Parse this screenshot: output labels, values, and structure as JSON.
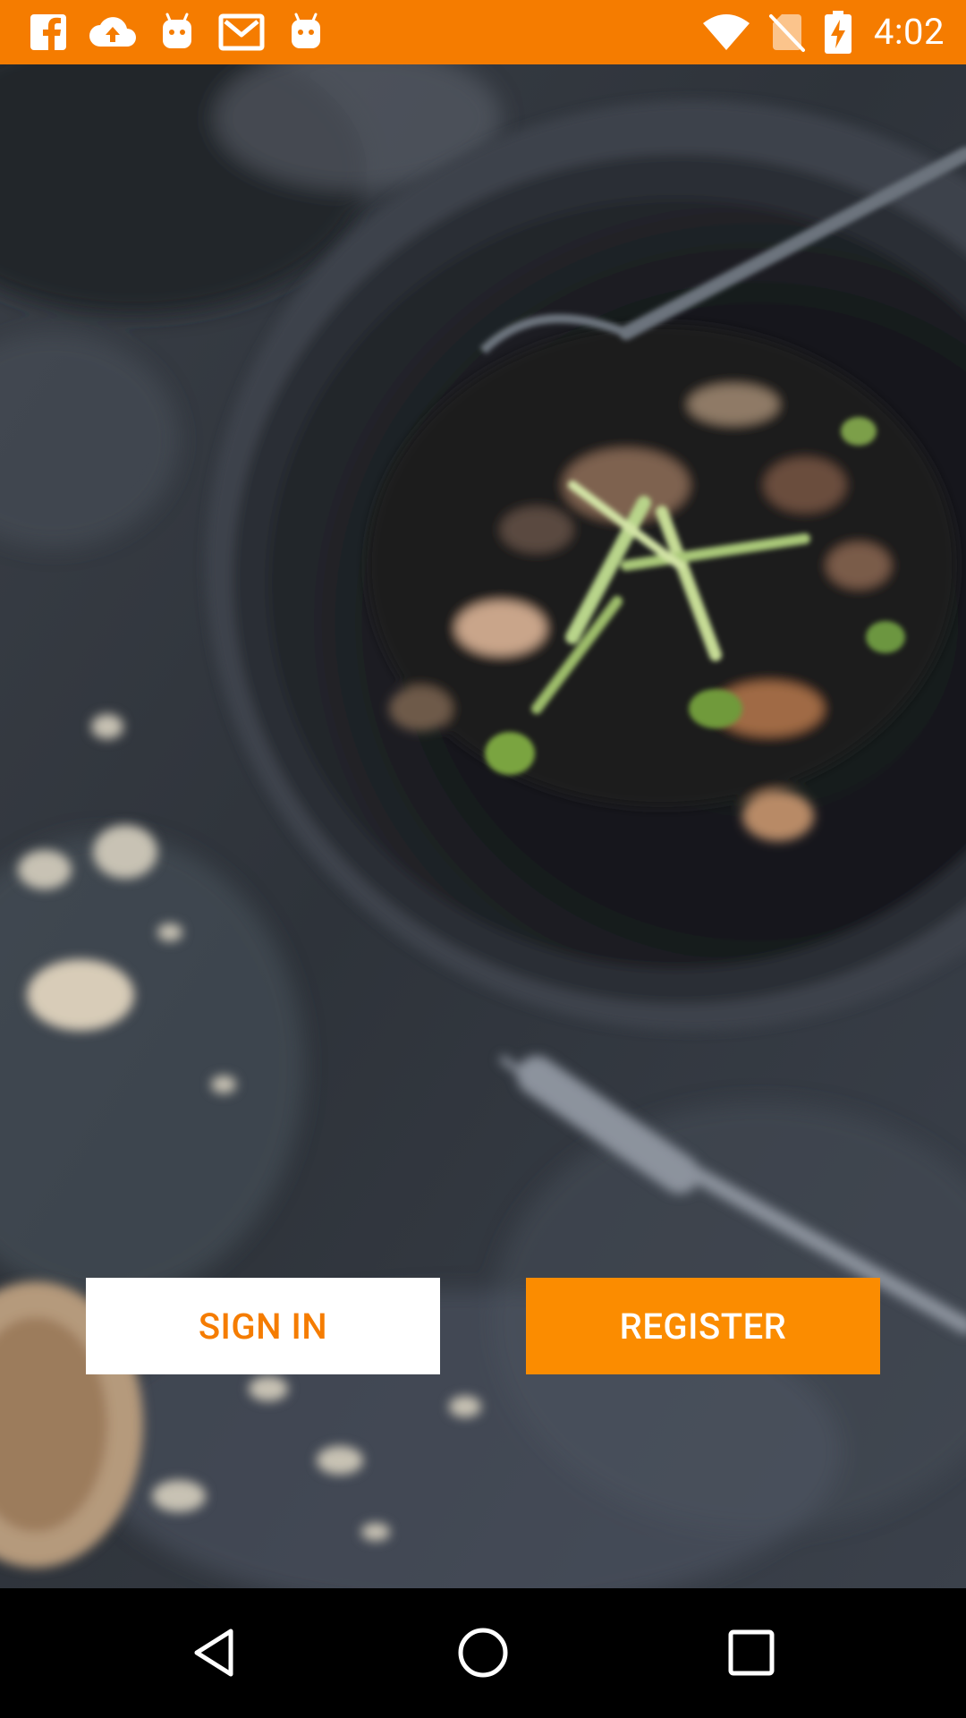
{
  "status_bar": {
    "time": "4:02",
    "background": "#f57c00",
    "left_icons": [
      "facebook-icon",
      "cloud-upload-icon",
      "android-icon",
      "gmail-icon",
      "android-icon"
    ],
    "right_icons": [
      "wifi-icon",
      "no-sim-icon",
      "battery-charging-icon"
    ]
  },
  "hero": {
    "background_image": "blurred-food-dish"
  },
  "actions": {
    "sign_in_label": "SIGN IN",
    "register_label": "REGISTER",
    "accent": "#f57c00",
    "register_background": "#fb8c00"
  },
  "nav_bar": {
    "buttons": [
      "back-icon",
      "home-icon",
      "recents-icon"
    ]
  }
}
